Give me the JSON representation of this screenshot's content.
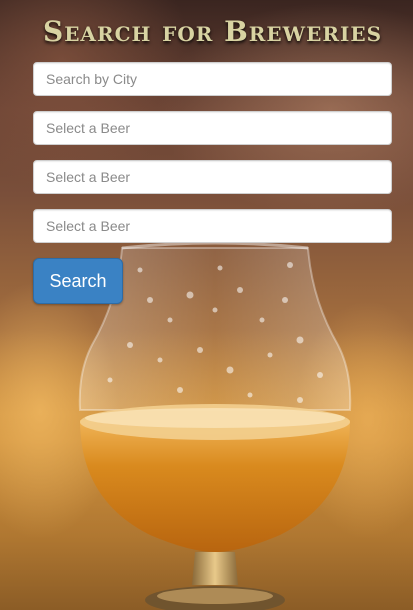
{
  "page": {
    "title": "Search for Breweries"
  },
  "form": {
    "city_placeholder": "Search by City",
    "beer_select_1_placeholder": "Select a Beer",
    "beer_select_2_placeholder": "Select a Beer",
    "beer_select_3_placeholder": "Select a Beer",
    "search_button_label": "Search"
  },
  "colors": {
    "title": "#d8d3a2",
    "button": "#3a82c4",
    "beer": "#d98a1e"
  }
}
